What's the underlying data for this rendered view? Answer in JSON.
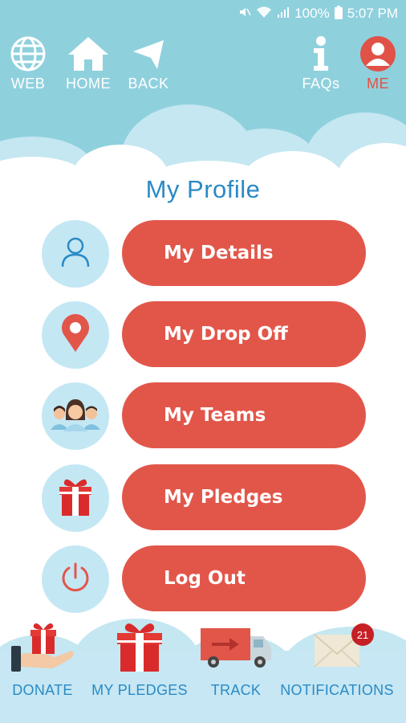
{
  "status_bar": {
    "battery": "100%",
    "time": "5:07 PM",
    "icons": [
      "mute-icon",
      "wifi-icon",
      "signal-icon",
      "battery-icon"
    ]
  },
  "top_nav": {
    "web": "WEB",
    "home": "HOME",
    "back": "BACK",
    "faqs": "FAQs",
    "me": "ME"
  },
  "page": {
    "title": "My Profile"
  },
  "menu": {
    "details": "My Details",
    "drop_off": "My Drop Off",
    "teams": "My Teams",
    "pledges": "My Pledges",
    "logout": "Log Out"
  },
  "bottom_nav": {
    "donate": "DONATE",
    "my_pledges": "MY PLEDGES",
    "track": "TRACK",
    "notifications": "NOTIFICATIONS",
    "notification_count": "21"
  },
  "colors": {
    "header_bg": "#8fd0dd",
    "accent_red": "#e2564a",
    "title_blue": "#2a8ac6",
    "icon_circle": "#c4e7f4"
  }
}
